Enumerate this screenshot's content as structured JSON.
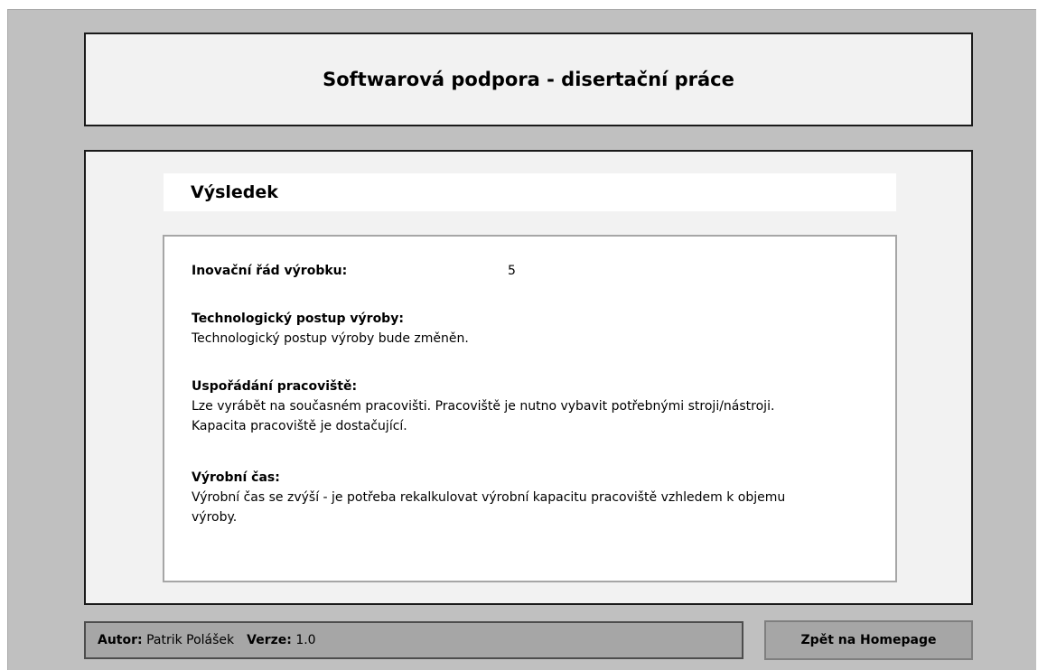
{
  "header": {
    "title": "Softwarová podpora - disertační práce"
  },
  "main": {
    "section_title": "Výsledek",
    "innovation": {
      "label": "Inovační řád výrobku:",
      "value": "5"
    },
    "sections": [
      {
        "label": "Technologický postup výroby:",
        "text": "Technologický postup výroby bude změněn."
      },
      {
        "label": "Uspořádání pracoviště:",
        "text_lines": [
          "Lze vyrábět na současném pracovišti. Pracoviště je nutno vybavit potřebnými stroji/nástroji.",
          "Kapacita pracoviště je dostačující."
        ]
      },
      {
        "label": "Výrobní čas:",
        "text_lines": [
          "Výrobní čas se zvýší - je potřeba rekalkulovat výrobní kapacitu pracoviště vzhledem k objemu",
          "výroby."
        ]
      }
    ]
  },
  "footer": {
    "author_label": "Autor:",
    "author_value": "Patrik Polášek",
    "version_label": "Verze:",
    "version_value": "1.0",
    "home_button_label": "Zpět na Homepage"
  },
  "colors": {
    "background": "#c0c0c0",
    "panel": "#f2f2f2",
    "footer": "#a6a6a6"
  }
}
